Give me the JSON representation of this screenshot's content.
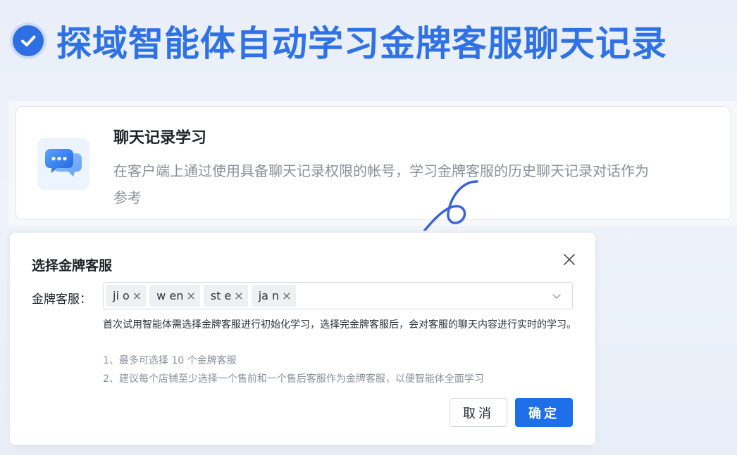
{
  "banner": {
    "title": "探域智能体自动学习金牌客服聊天记录",
    "icon": "check-circle-icon",
    "accent": "#2f72e6"
  },
  "feature": {
    "icon": "chat-bubbles-icon",
    "title": "聊天记录学习",
    "description": "在客户端上通过使用具备聊天记录权限的帐号，学习金牌客服的历史聊天记录对话作为参考"
  },
  "annotation": {
    "icon": "hand-drawn-arrow-icon",
    "color": "#3a64d8"
  },
  "modal": {
    "title": "选择金牌客服",
    "field_label": "金牌客服：",
    "selected_tags": [
      {
        "label": "ji     o"
      },
      {
        "label": "w       en"
      },
      {
        "label": "st     e"
      },
      {
        "label": "ja     n"
      }
    ],
    "help_text": "首次试用智能体需选择金牌客服进行初始化学习，选择完金牌客服后，会对客服的聊天内容进行实时的学习。",
    "note_1": "1、最多可选择 10 个金牌客服",
    "note_2": "2、建议每个店铺至少选择一个售前和一个售后客服作为金牌客服，以便智能体全面学习",
    "cancel_label": "取消",
    "confirm_label": "确定",
    "confirm_color": "#1e6fe8"
  }
}
